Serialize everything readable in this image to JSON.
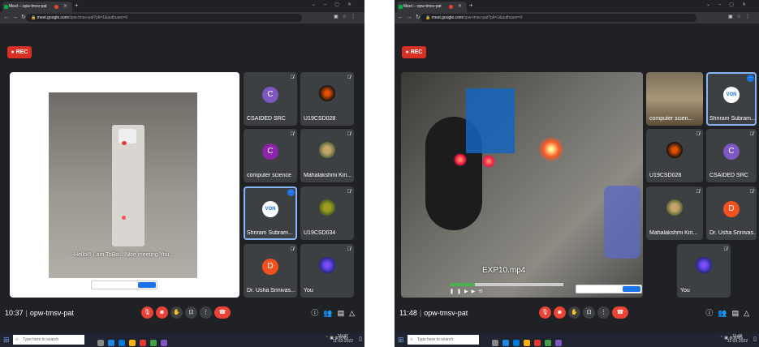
{
  "shared": {
    "tab_title": "Meet – opw-tmsv-pat",
    "url_host": "meet.google.com",
    "url_path": "/opw-tmsv-pat?pli=1&authuser=0",
    "rec_label": "REC",
    "meeting_code": "opw-tmsv-pat",
    "search_placeholder": "Type here to search",
    "tray_lang": "ENG"
  },
  "left": {
    "time": "10:37",
    "clock_time": "10:37",
    "clock_date": "11-03-2022",
    "subtitle": "-Hello!!! I am ToBo... Nice meeting You...",
    "tiles": [
      {
        "name": "CSAIDED SRC",
        "avatar": "C",
        "color": "#7e57c2"
      },
      {
        "name": "U19CSD028"
      },
      {
        "name": "computer science",
        "avatar": "C",
        "color": "#8e24aa"
      },
      {
        "name": "Mahalakshmi Kiri..."
      },
      {
        "name": "Shriram Subram..."
      },
      {
        "name": "U19CSD034"
      },
      {
        "name": "Dr. Usha Srinivas...",
        "avatar": "D",
        "color": "#f4511e"
      },
      {
        "name": "You"
      }
    ]
  },
  "right": {
    "time": "11:48",
    "clock_time": "11:48",
    "clock_date": "11-03-2022",
    "video_title": "EXP10.mp4",
    "tiles": [
      {
        "name": "computer scien..."
      },
      {
        "name": "Shriram Subram..."
      },
      {
        "name": "U19CSD028"
      },
      {
        "name": "CSAIDED SRC",
        "avatar": "C",
        "color": "#7e57c2"
      },
      {
        "name": "Mahalakshmi Kiri..."
      },
      {
        "name": "Dr. Usha Srinivas...",
        "avatar": "D",
        "color": "#f4511e"
      },
      {
        "name": "You"
      }
    ]
  }
}
